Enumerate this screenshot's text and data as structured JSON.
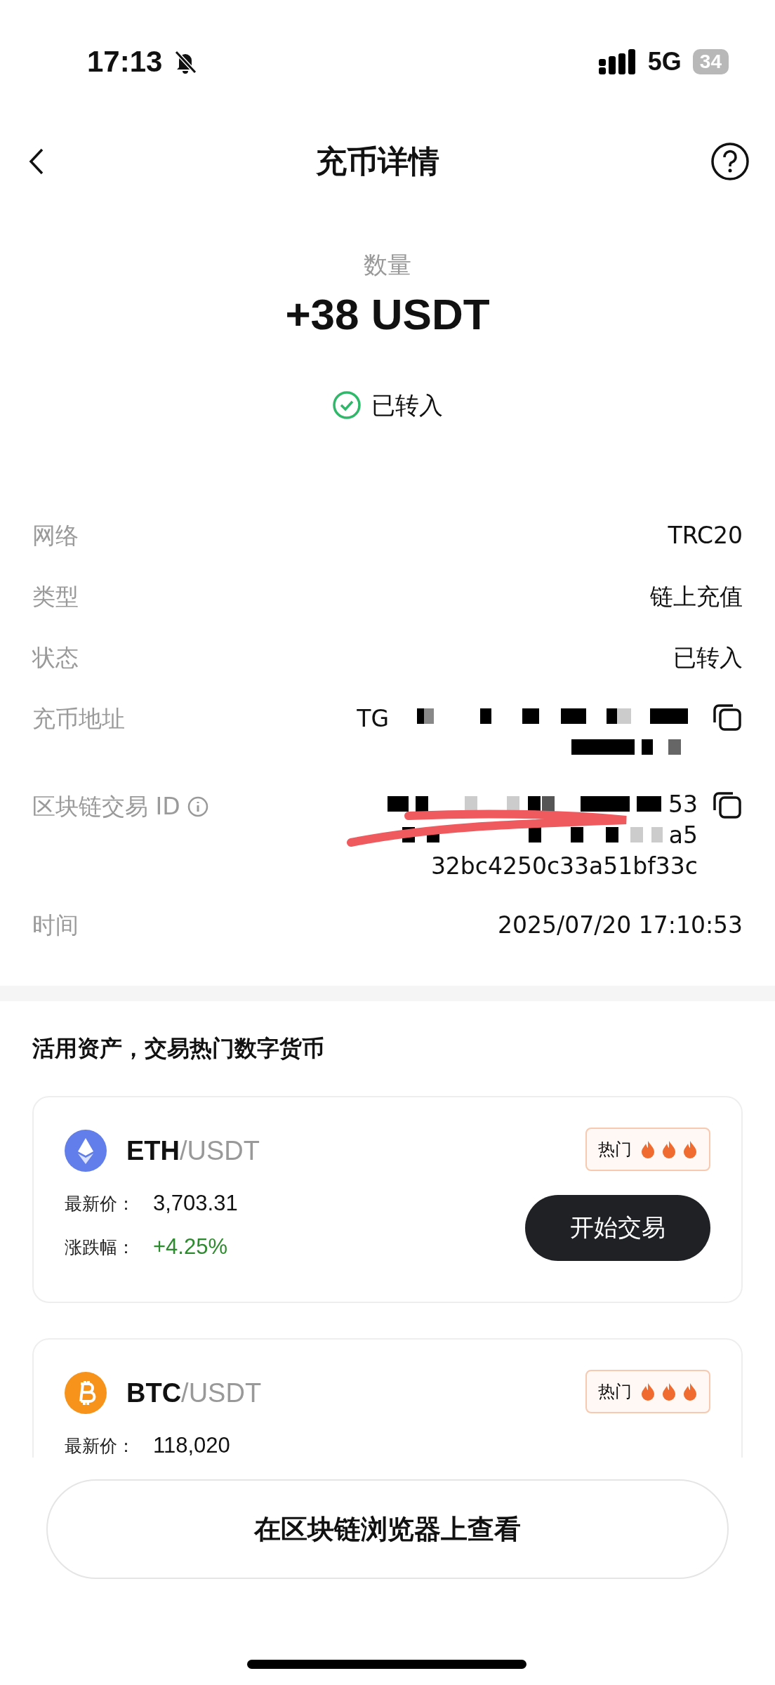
{
  "status_bar": {
    "time": "17:13",
    "network": "5G",
    "battery": "34"
  },
  "nav": {
    "title": "充币详情"
  },
  "summary": {
    "label": "数量",
    "amount": "+38 USDT",
    "status": {
      "text": "已转入",
      "done": true
    }
  },
  "details": [
    {
      "kind": "text",
      "label": "网络",
      "value": "TRC20"
    },
    {
      "kind": "text",
      "label": "类型",
      "value": "链上充值"
    },
    {
      "kind": "text",
      "label": "状态",
      "value": "已转入"
    },
    {
      "kind": "address",
      "label": "充币地址",
      "value": "TG",
      "copyable": true
    },
    {
      "kind": "txid",
      "label": "区块链交易 ID",
      "info": true,
      "lines": [
        "53",
        "a5",
        "32bc4250c33a51bf33c"
      ],
      "copyable": true
    },
    {
      "kind": "text",
      "label": "时间",
      "value": "2025/07/20 17:10:53"
    }
  ],
  "promo": {
    "title": "活用资产，交易热门数字货币",
    "cards": [
      {
        "kind": "eth",
        "base": "ETH",
        "quote": "/USDT",
        "badge": "热门",
        "price_label": "最新价：",
        "price": "3,703.31",
        "change_label": "涨跌幅：",
        "change": "+4.25%",
        "action": "开始交易"
      },
      {
        "kind": "btc",
        "base": "BTC",
        "quote": "/USDT",
        "badge": "热门",
        "price_label": "最新价：",
        "price": "118,020"
      }
    ]
  },
  "footer_button": "在区块链浏览器上查看"
}
